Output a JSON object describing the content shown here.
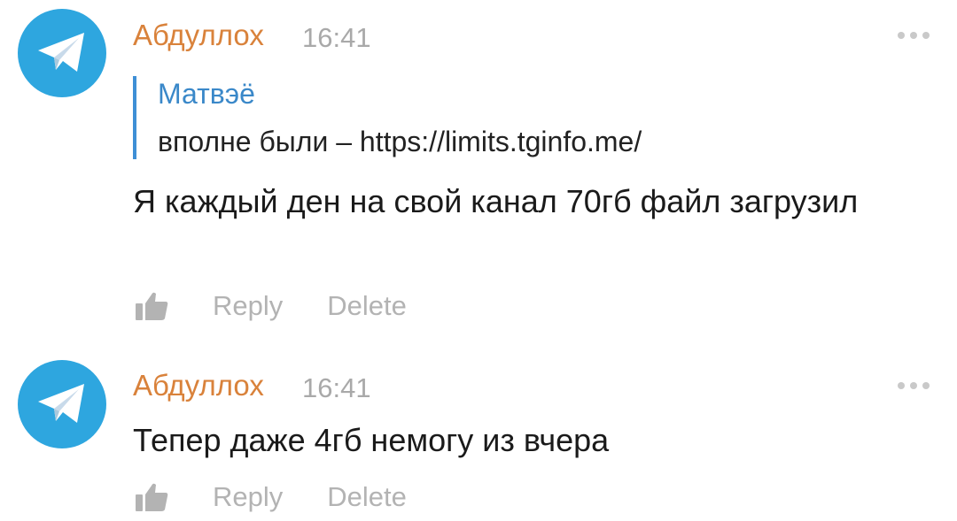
{
  "comments": [
    {
      "author": "Абдуллох",
      "time": "16:41",
      "quote": {
        "author": "Матвэё",
        "text": "вполне были – https://limits.tginfo.me/"
      },
      "text": "Я каждый ден на свой канал 70гб файл загрузил",
      "actions": {
        "reply": "Reply",
        "delete": "Delete"
      }
    },
    {
      "author": "Абдуллох",
      "time": "16:41",
      "text": "Тепер даже 4гб немогу из вчера",
      "actions": {
        "reply": "Reply",
        "delete": "Delete"
      }
    }
  ],
  "icons": {
    "avatar": "telegram-plane-icon",
    "like": "thumbs-up-icon",
    "more": "more-dots-icon"
  },
  "colors": {
    "avatar_bg": "#2ea6df",
    "author": "#d9823b",
    "quote_author": "#3a88c9",
    "quote_bar": "#3e8fd6",
    "muted": "#b3b3b3"
  }
}
